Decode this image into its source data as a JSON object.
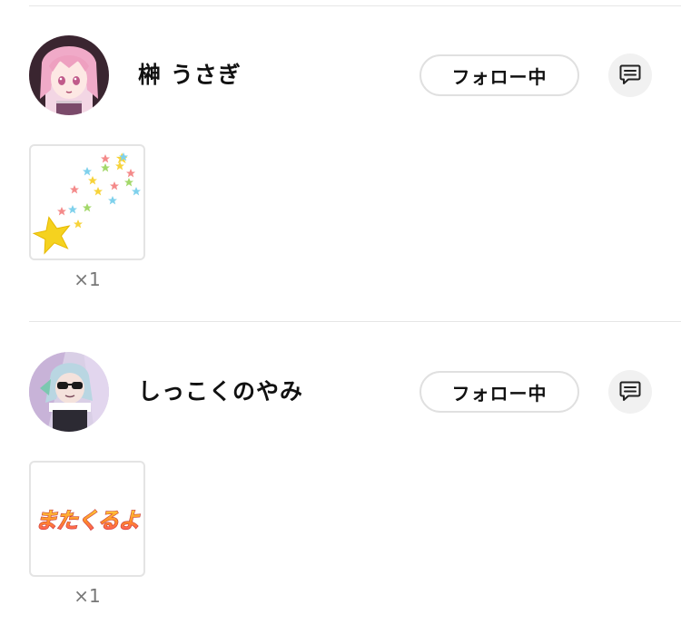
{
  "supporters": [
    {
      "name": "榊 うさぎ",
      "follow_label": "フォロー中",
      "avatar_icon": "avatar-pink-hair-girl-icon",
      "gift": {
        "icon": "shooting-stars-icon",
        "count": "×1"
      }
    },
    {
      "name": "しっこくのやみ",
      "follow_label": "フォロー中",
      "avatar_icon": "avatar-sunglasses-character-icon",
      "gift": {
        "icon": "matakuruyo-text-sticker-icon",
        "sticker_text": "またくるよ",
        "count": "×1"
      }
    }
  ],
  "colors": {
    "button_border": "#e0e0e0",
    "message_bg": "#f1f1f1",
    "count_text": "#777777",
    "divider": "#e6e6e6"
  }
}
